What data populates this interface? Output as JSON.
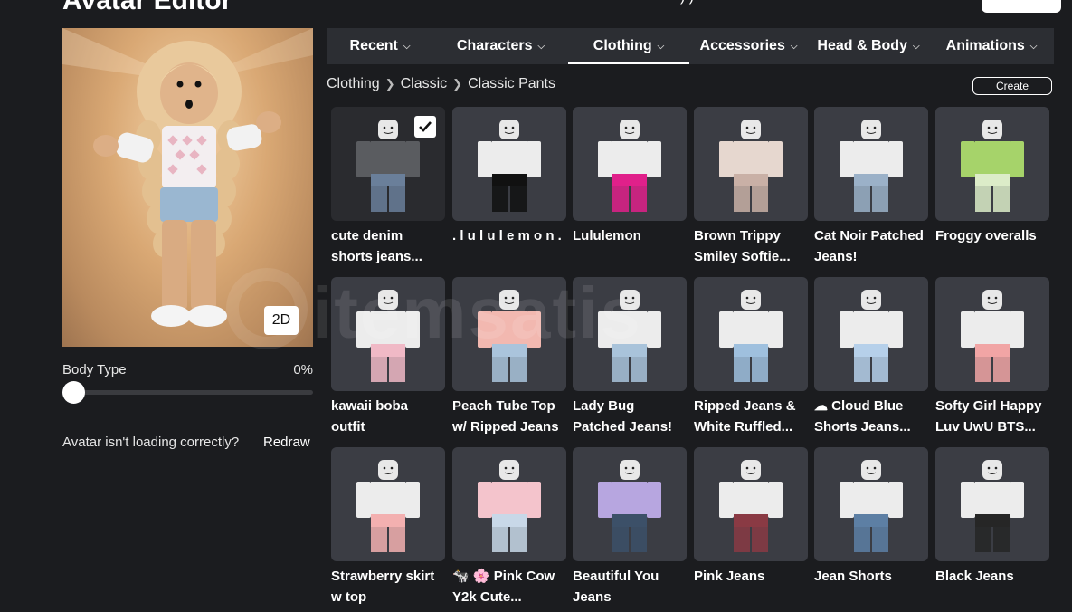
{
  "page": {
    "title": "Avatar Editor",
    "top_right_fragment": ") )"
  },
  "avatar": {
    "view_toggle": "2D",
    "body_type_label": "Body Type",
    "body_type_value": "0%",
    "body_type_level": 0,
    "redraw_prompt": "Avatar isn't loading correctly?",
    "redraw_link": "Redraw"
  },
  "tabs": [
    {
      "label": "Recent",
      "active": false
    },
    {
      "label": "Characters",
      "active": false
    },
    {
      "label": "Clothing",
      "active": true
    },
    {
      "label": "Accessories",
      "active": false
    },
    {
      "label": "Head & Body",
      "active": false
    },
    {
      "label": "Animations",
      "active": false
    }
  ],
  "breadcrumb": [
    "Clothing",
    "Classic",
    "Classic Pants"
  ],
  "create_label": "Create",
  "items": [
    {
      "line1": "cute denim",
      "line2": "shorts jeans...",
      "selected": true,
      "top": "#5a5c60",
      "pants": "#6a7f9a"
    },
    {
      "line1": ". l u l u l e m o n .",
      "line2": "",
      "selected": false,
      "top": "#ececec",
      "pants": "#111111"
    },
    {
      "line1": "Lululemon",
      "line2": "",
      "selected": false,
      "top": "#ececec",
      "pants": "#e0208a"
    },
    {
      "line1": "Brown Trippy",
      "line2": "Smiley Softie...",
      "selected": false,
      "top": "#e6d7cf",
      "pants": "#c9b0a6"
    },
    {
      "line1": "Cat Noir Patched",
      "line2": "Jeans!",
      "selected": false,
      "top": "#ececec",
      "pants": "#9bb1c8"
    },
    {
      "line1": "Froggy overalls",
      "line2": "",
      "selected": false,
      "top": "#a6d36a",
      "pants": "#dcecc8"
    },
    {
      "line1": "kawaii boba",
      "line2": "outfit",
      "selected": false,
      "top": "#ececec",
      "pants": "#f0b9c6"
    },
    {
      "line1": "Peach Tube Top",
      "line2": "w/ Ripped Jeans",
      "selected": false,
      "top": "#f2b8b0",
      "pants": "#aac4dc"
    },
    {
      "line1": "Lady Bug",
      "line2": "Patched Jeans!",
      "selected": false,
      "top": "#ececec",
      "pants": "#a9c3da"
    },
    {
      "line1": "Ripped Jeans &",
      "line2": "White Ruffled...",
      "selected": false,
      "top": "#ececec",
      "pants": "#9fc0de"
    },
    {
      "line1": "☁ Cloud Blue",
      "line2": "Shorts Jeans...",
      "selected": false,
      "top": "#ececec",
      "pants": "#b6d0ea"
    },
    {
      "line1": "Softy Girl Happy",
      "line2": "Luv UwU BTS...",
      "selected": false,
      "top": "#ececec",
      "pants": "#f1a5a5"
    },
    {
      "line1": "Strawberry skirt",
      "line2": "w top",
      "selected": false,
      "top": "#ececec",
      "pants": "#f3b0b0"
    },
    {
      "line1": "🐄 🌸 Pink Cow",
      "line2": "Y2k Cute...",
      "selected": false,
      "top": "#f4c4cc",
      "pants": "#c8d8e8"
    },
    {
      "line1": "Beautiful You",
      "line2": "Jeans",
      "selected": false,
      "top": "#b7a6e0",
      "pants": "#3c5068"
    },
    {
      "line1": "Pink Jeans",
      "line2": "",
      "selected": false,
      "top": "#ececec",
      "pants": "#8a3a44"
    },
    {
      "line1": "Jean Shorts",
      "line2": "",
      "selected": false,
      "top": "#ececec",
      "pants": "#5d7fa4"
    },
    {
      "line1": "Black Jeans",
      "line2": "",
      "selected": false,
      "top": "#ececec",
      "pants": "#262626"
    }
  ],
  "watermark": "itemsatis"
}
